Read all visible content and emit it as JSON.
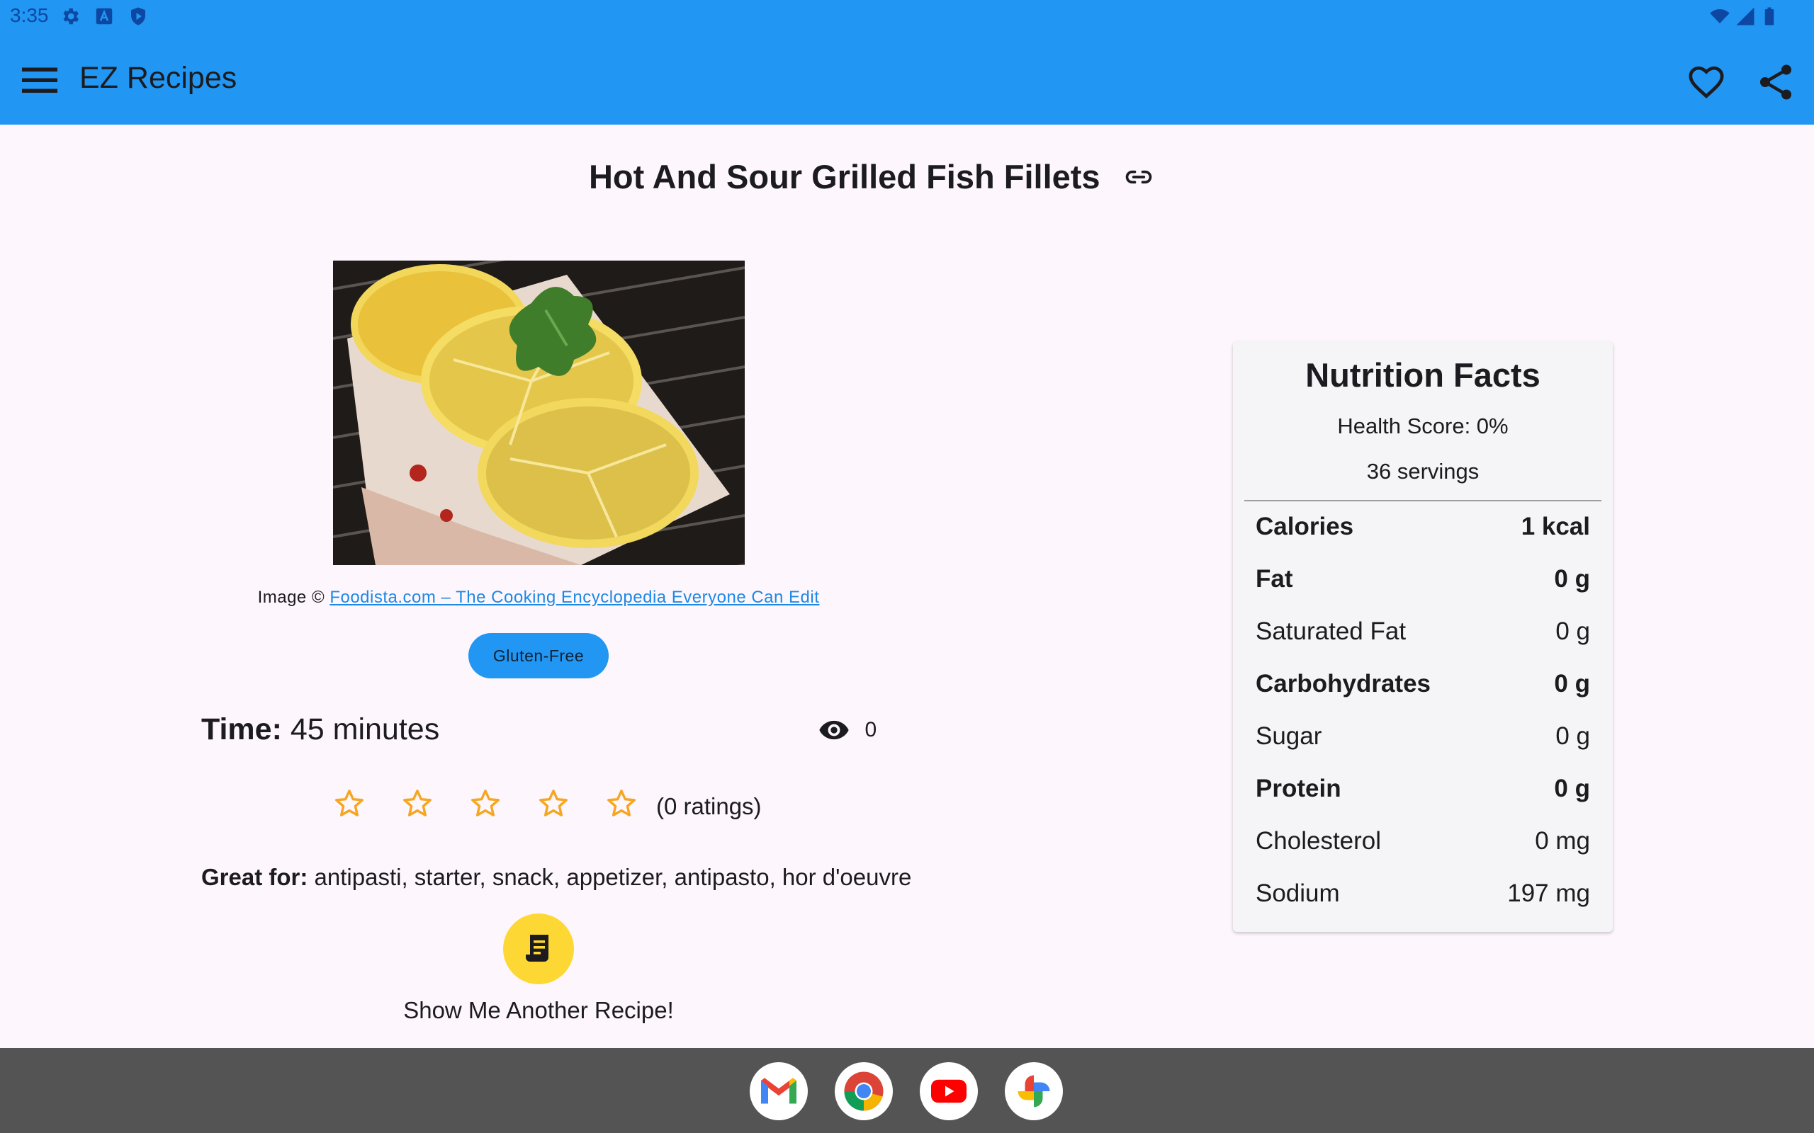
{
  "status_bar": {
    "time": "3:35"
  },
  "app_bar": {
    "title": "EZ Recipes"
  },
  "recipe": {
    "title": "Hot And Sour Grilled Fish Fillets",
    "image_credit_prefix": "Image ©",
    "image_credit_link": "Foodista.com – The Cooking Encyclopedia Everyone Can Edit",
    "chip": "Gluten-Free",
    "time_label": "Time:",
    "time_value": "45 minutes",
    "views": "0",
    "ratings": "(0 ratings)",
    "great_for_label": "Great for:",
    "great_for_value": "antipasti, starter, snack, appetizer, antipasto, hor d'oeuvre",
    "fab_label": "Show Me Another Recipe!"
  },
  "nutrition": {
    "title": "Nutrition Facts",
    "health_score": "Health Score: 0%",
    "servings": "36 servings",
    "rows": [
      {
        "label": "Calories",
        "value": "1 kcal",
        "bold": true
      },
      {
        "label": "Fat",
        "value": "0 g",
        "bold": true
      },
      {
        "label": "Saturated Fat",
        "value": "0 g",
        "bold": false
      },
      {
        "label": "Carbohydrates",
        "value": "0 g",
        "bold": true
      },
      {
        "label": "Sugar",
        "value": "0 g",
        "bold": false
      },
      {
        "label": "Protein",
        "value": "0 g",
        "bold": true
      },
      {
        "label": "Cholesterol",
        "value": "0 mg",
        "bold": false
      },
      {
        "label": "Sodium",
        "value": "197 mg",
        "bold": false
      }
    ]
  },
  "colors": {
    "primary": "#2196f3",
    "fab": "#fdd835",
    "star": "#f5a623",
    "link": "#1e88e5",
    "dock": "#545454"
  },
  "icons": [
    "settings-icon",
    "a-icon",
    "shield-play-icon",
    "wifi-icon",
    "signal-icon",
    "battery-icon",
    "menu-icon",
    "heart-outline-icon",
    "share-icon",
    "link-icon",
    "eye-icon",
    "star-outline-icon",
    "receipt-icon",
    "gmail-icon",
    "chrome-icon",
    "youtube-icon",
    "photos-icon"
  ]
}
